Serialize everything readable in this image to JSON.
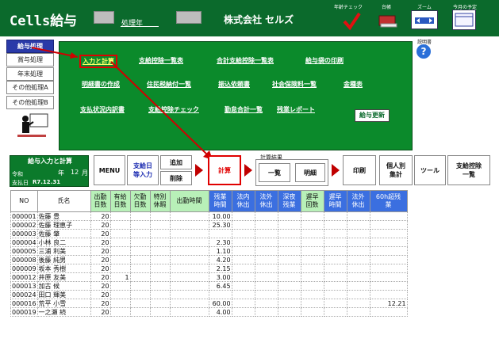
{
  "header": {
    "app_title": "Cells給与",
    "period_label": "処理年",
    "company": "株式会社 セルズ",
    "tools": [
      "年齢チェック",
      "台帳",
      "ズーム",
      "今月の予定"
    ]
  },
  "side_nav": [
    "給与処理",
    "賞与処理",
    "年末処理",
    "その他処理A",
    "その他処理B"
  ],
  "help_label": "説明書",
  "menu": {
    "row1": [
      "入力と計算",
      "支給控除一覧表",
      "合計支給控除一覧表",
      "給与袋の印刷"
    ],
    "row2": [
      "明細書の作成",
      "住民税納付一覧",
      "振込依頼書",
      "社会保険料一覧",
      "金種表"
    ],
    "row3": [
      "支払状況内訳書",
      "支給控除チェック",
      "勤怠合計一覧",
      "残業レポート"
    ],
    "update_button": "給与更新"
  },
  "panel": {
    "title": "給与入力と計算",
    "reiwa": "令和",
    "year_suffix": "年",
    "month": "12",
    "month_suffix": "月",
    "pay_date_label": "支払日",
    "pay_date": "R7.12.31"
  },
  "toolbar": {
    "menu": "MENU",
    "bulk_input": "支給日\n等入力",
    "add": "追加",
    "delete": "削除",
    "calc": "計算",
    "calc_result_label": "計算結果",
    "list": "一覧",
    "detail": "明細",
    "print": "印刷",
    "individual": "個人別\n集計",
    "tools": "ツール",
    "deduction_list": "支給控除\n一覧"
  },
  "table": {
    "headers": [
      "NO",
      "氏名",
      "出勤\n日数",
      "有給\n日数",
      "欠勤\n日数",
      "特別\n休暇",
      "出勤時間",
      "残業\n時間",
      "法内\n休出",
      "法外\n休出",
      "深夜\n残業",
      "遅早\n回数",
      "遅早\n時間",
      "法外\n休出",
      "60h超残\n業"
    ],
    "rows": [
      [
        "000001",
        "佐藤 豊",
        "20",
        "",
        "",
        "",
        "",
        "10.00",
        "",
        "",
        "",
        "",
        "",
        "",
        ""
      ],
      [
        "000002",
        "佐藤 理恵子",
        "20",
        "",
        "",
        "",
        "",
        "25.30",
        "",
        "",
        "",
        "",
        "",
        "",
        ""
      ],
      [
        "000003",
        "佐藤 肇",
        "20",
        "",
        "",
        "",
        "",
        "",
        "",
        "",
        "",
        "",
        "",
        "",
        ""
      ],
      [
        "000004",
        "小林 良二",
        "20",
        "",
        "",
        "",
        "",
        "2.30",
        "",
        "",
        "",
        "",
        "",
        "",
        ""
      ],
      [
        "000005",
        "三浦 利美",
        "20",
        "",
        "",
        "",
        "",
        "1.10",
        "",
        "",
        "",
        "",
        "",
        "",
        ""
      ],
      [
        "000008",
        "後藤 純男",
        "20",
        "",
        "",
        "",
        "",
        "4.20",
        "",
        "",
        "",
        "",
        "",
        "",
        ""
      ],
      [
        "000009",
        "坂本 秀樹",
        "20",
        "",
        "",
        "",
        "",
        "2.15",
        "",
        "",
        "",
        "",
        "",
        "",
        ""
      ],
      [
        "000012",
        "井原 友美",
        "20",
        "1",
        "",
        "",
        "",
        "3.00",
        "",
        "",
        "",
        "",
        "",
        "",
        ""
      ],
      [
        "000013",
        "加古 候",
        "20",
        "",
        "",
        "",
        "",
        "6.45",
        "",
        "",
        "",
        "",
        "",
        "",
        ""
      ],
      [
        "000024",
        "田口 輝美",
        "20",
        "",
        "",
        "",
        "",
        "",
        "",
        "",
        "",
        "",
        "",
        "",
        ""
      ],
      [
        "000016",
        "荒平 小雪",
        "20",
        "",
        "",
        "",
        "",
        "60.00",
        "",
        "",
        "",
        "",
        "",
        "",
        "12.21"
      ],
      [
        "000019",
        "一之瀬 続",
        "20",
        "",
        "",
        "",
        "",
        "4.00",
        "",
        "",
        "",
        "",
        "",
        "",
        ""
      ]
    ]
  },
  "colors": {
    "header_bg": "#0b6a2c",
    "menu_bg": "#0b8a2b",
    "accent_red": "#e00000",
    "header_blue": "#3b6fe0",
    "header_green": "#b8f0b8"
  }
}
